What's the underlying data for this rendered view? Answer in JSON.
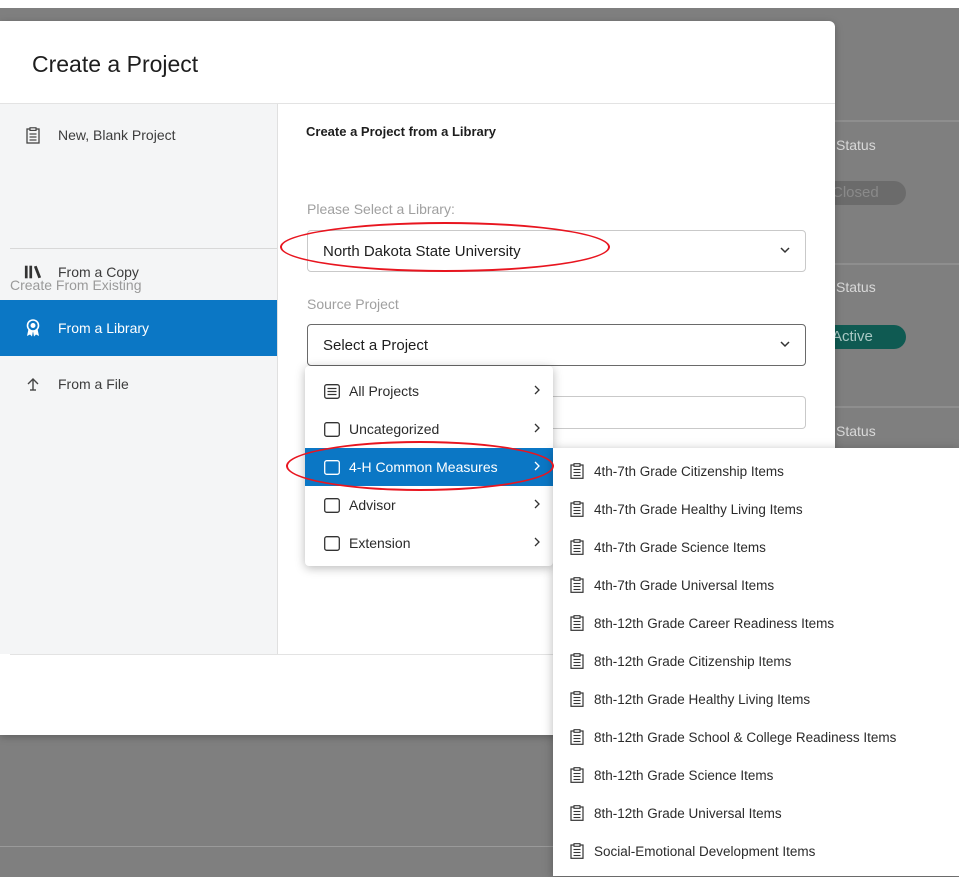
{
  "modal": {
    "title": "Create a Project"
  },
  "sidebar": {
    "blank_label": "New, Blank Project",
    "section_label": "Create From Existing",
    "items": [
      {
        "label": "From a Copy",
        "icon": "books-icon"
      },
      {
        "label": "From a Library",
        "icon": "ribbon-icon",
        "active": true
      },
      {
        "label": "From a File",
        "icon": "upload-arrow-icon"
      }
    ]
  },
  "content": {
    "heading": "Create a Project from a Library",
    "library_label": "Please Select a Library:",
    "library_value": "North Dakota State University",
    "source_label": "Source Project",
    "source_value": "Select a Project"
  },
  "menu": {
    "items": [
      {
        "label": "All Projects",
        "icon": "list-icon"
      },
      {
        "label": "Uncategorized",
        "icon": "folder-icon"
      },
      {
        "label": "4-H Common Measures",
        "icon": "folder-icon",
        "active": true
      },
      {
        "label": "Advisor",
        "icon": "folder-icon"
      },
      {
        "label": "Extension",
        "icon": "folder-icon"
      }
    ]
  },
  "submenu": {
    "items": [
      "4th-7th Grade Citizenship Items",
      "4th-7th Grade Healthy Living Items",
      "4th-7th Grade Science Items",
      "4th-7th Grade Universal Items",
      "8th-12th Grade Career Readiness Items",
      "8th-12th Grade Citizenship Items",
      "8th-12th Grade Healthy Living Items",
      "8th-12th Grade School & College Readiness Items",
      "8th-12th Grade Science Items",
      "8th-12th Grade Universal Items",
      "Social-Emotional Development Items"
    ]
  },
  "background": {
    "status_label": "Status",
    "status_closed": "Closed",
    "status_active": "Active"
  },
  "colors": {
    "accent": "#0b77c5",
    "annotation": "#e8151f",
    "active_pill": "#0f5a52"
  }
}
